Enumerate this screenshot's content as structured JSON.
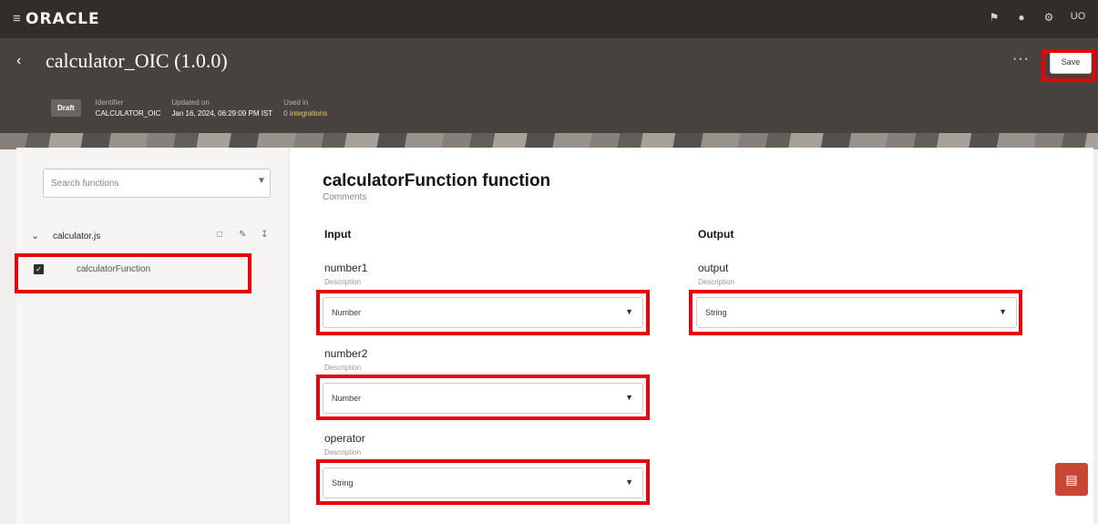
{
  "nav": {
    "menu_icon": "hamburger-icon",
    "logo": "ORACLE",
    "icons": [
      "notifications-icon",
      "help-icon",
      "settings-icon"
    ],
    "user_initials": "UO"
  },
  "header": {
    "title": "calculator_OIC (1.0.0)",
    "more_label": "···",
    "save_label": "Save",
    "status_badge": "Draft",
    "identifier_label": "Identifier",
    "identifier_value": "CALCULATOR_OIC",
    "updated_label": "Updated on",
    "updated_value": "Jan 16, 2024, 06:29:09 PM IST",
    "used_in_label": "Used in",
    "used_in_value": "0 integrations"
  },
  "sidebar": {
    "search_placeholder": "Search functions",
    "file_name": "calculator.js",
    "functions": [
      {
        "label": "calculatorFunction",
        "selected": true
      }
    ]
  },
  "main": {
    "title": "calculatorFunction function",
    "comments_label": "Comments",
    "input_heading": "Input",
    "output_heading": "Output",
    "inputs": [
      {
        "name": "number1",
        "description": "Description",
        "type": "Number"
      },
      {
        "name": "number2",
        "description": "Description",
        "type": "Number"
      },
      {
        "name": "operator",
        "description": "Description",
        "type": "String"
      }
    ],
    "output": {
      "name": "output",
      "description": "Description",
      "type": "String"
    }
  },
  "colors": {
    "nav_bg": "#312d2a",
    "header_bg": "#47423e",
    "highlight": "#e8000b",
    "chat_button": "#c74634"
  }
}
